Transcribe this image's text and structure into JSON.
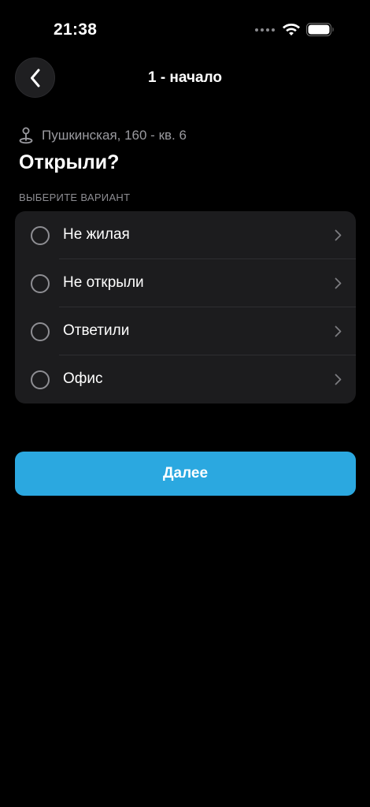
{
  "status_bar": {
    "time": "21:38",
    "icons": [
      "signal-dots-icon",
      "wifi-icon",
      "battery-icon"
    ]
  },
  "nav": {
    "back_icon": "chevron-left-icon",
    "title": "1 - начало"
  },
  "address": {
    "icon": "map-pin-icon",
    "text": "Пушкинская, 160 - кв. 6"
  },
  "question": "Открыли?",
  "section_label": "ВЫБЕРИТЕ ВАРИАНТ",
  "options": [
    {
      "label": "Не жилая",
      "selected": false
    },
    {
      "label": "Не открыли",
      "selected": false
    },
    {
      "label": "Ответили",
      "selected": false
    },
    {
      "label": "Офис",
      "selected": false
    }
  ],
  "next_button": {
    "label": "Далее"
  },
  "colors": {
    "background": "#000000",
    "card": "#1c1c1e",
    "accent": "#2ba8e0",
    "secondary_text": "#9a9a9f"
  }
}
